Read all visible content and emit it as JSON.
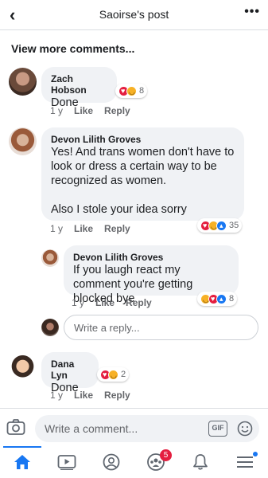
{
  "header": {
    "title": "Saoirse's post",
    "back_icon": "back-chevron-icon",
    "more_icon": "more-dots-icon"
  },
  "view_more_label": "View more comments...",
  "comments": [
    {
      "author": "Zach Hobson",
      "text": "Done",
      "time": "1 y",
      "like_label": "Like",
      "reply_label": "Reply",
      "reactions": [
        "heart",
        "haha"
      ],
      "reaction_count": "8"
    },
    {
      "author": "Devon Lilith Groves",
      "text": "Yes! And trans women don't have to look or dress a certain way to be recognized as women.\n\nAlso I stole your idea sorry",
      "time": "1 y",
      "like_label": "Like",
      "reply_label": "Reply",
      "reactions": [
        "heart",
        "haha",
        "like"
      ],
      "reaction_count": "35"
    },
    {
      "author": "Devon Lilith Groves",
      "text": "If you laugh react my comment you're getting blocked bye",
      "time": "1 y",
      "like_label": "Like",
      "reply_label": "Reply",
      "reactions": [
        "haha",
        "heart",
        "like"
      ],
      "reaction_count": "8"
    },
    {
      "author": "Dana Lyn",
      "text": "Done",
      "time": "1 y",
      "like_label": "Like",
      "reply_label": "Reply",
      "reactions": [
        "heart",
        "haha"
      ],
      "reaction_count": "2"
    }
  ],
  "reply_input": {
    "placeholder": "Write a reply..."
  },
  "comment_input": {
    "placeholder": "Write a comment...",
    "gif_label": "GIF"
  },
  "tabbar": {
    "items": [
      {
        "name": "home",
        "icon": "home-icon",
        "active": true
      },
      {
        "name": "watch",
        "icon": "video-icon"
      },
      {
        "name": "profile",
        "icon": "profile-icon"
      },
      {
        "name": "groups",
        "icon": "groups-icon",
        "badge": "5"
      },
      {
        "name": "notifications",
        "icon": "bell-icon"
      },
      {
        "name": "menu",
        "icon": "menu-icon"
      }
    ]
  },
  "colors": {
    "accent": "#1877f2",
    "badge": "#e41e3f",
    "bubble": "#f0f2f5",
    "secondary_text": "#65676b"
  }
}
